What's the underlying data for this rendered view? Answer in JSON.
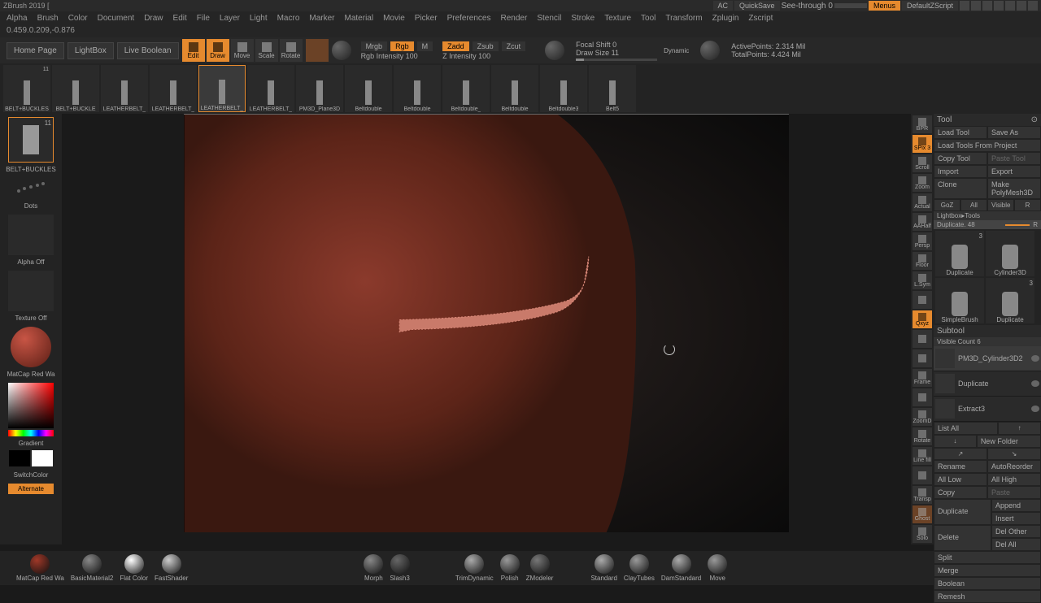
{
  "title": "ZBrush 2019 [",
  "titlebar": {
    "ac": "AC",
    "quicksave": "QuickSave",
    "seethrough": "See-through  0",
    "menus": "Menus",
    "default_script": "DefaultZScript"
  },
  "menu": [
    "Alpha",
    "Brush",
    "Color",
    "Document",
    "Draw",
    "Edit",
    "File",
    "Layer",
    "Light",
    "Macro",
    "Marker",
    "Material",
    "Movie",
    "Picker",
    "Preferences",
    "Render",
    "Stencil",
    "Stroke",
    "Texture",
    "Tool",
    "Transform",
    "Zplugin",
    "Zscript"
  ],
  "coords": "0.459.0.209,-0.876",
  "topbar": {
    "home": "Home Page",
    "lightbox": "LightBox",
    "live_boolean": "Live Boolean",
    "modes": [
      "Edit",
      "Draw",
      "Move",
      "Scale",
      "Rotate"
    ],
    "mrgb": "Mrgb",
    "rgb": "Rgb",
    "m": "M",
    "rgb_intensity": "Rgb Intensity 100",
    "zadd": "Zadd",
    "zsub": "Zsub",
    "zcut": "Zcut",
    "z_intensity": "Z Intensity 100",
    "focal_shift": "Focal Shift 0",
    "draw_size": "Draw Size 11",
    "dynamic": "Dynamic",
    "active_points": "ActivePoints: 2.314 Mil",
    "total_points": "TotalPoints: 4.424 Mil"
  },
  "thumbnails": [
    {
      "label": "BELT+BUCKLES",
      "badge": "11"
    },
    {
      "label": "BELT+BUCKLE"
    },
    {
      "label": "LEATHERBELT_"
    },
    {
      "label": "LEATHERBELT_"
    },
    {
      "label": "LEATHERBELT_",
      "selected": true
    },
    {
      "label": "LEATHERBELT_"
    },
    {
      "label": "PM3D_Plane3D"
    },
    {
      "label": "Beltdouble"
    },
    {
      "label": "Beltdouble"
    },
    {
      "label": "Beltdouble_"
    },
    {
      "label": "Beltdouble"
    },
    {
      "label": "Beltdouble3"
    },
    {
      "label": "Belt5"
    }
  ],
  "left_panel": {
    "brush_label": "BELT+BUCKLES",
    "dots": "Dots",
    "alpha_off": "Alpha Off",
    "texture_off": "Texture Off",
    "material": "MatCap Red Wa",
    "gradient": "Gradient",
    "switch_color": "SwitchColor",
    "alternate": "Alternate"
  },
  "right_shelf": [
    "BPR",
    "SPix 3",
    "Scroll",
    "Zoom",
    "Actual",
    "AAHalf",
    "Persp",
    "Floor",
    "L.Sym",
    "",
    "Qxyz",
    "",
    "",
    "Frame",
    "",
    "ZoomD",
    "Rotate",
    "Line fill",
    "",
    "Transp",
    "Ghost",
    "Solo"
  ],
  "tool_panel": {
    "header": "Tool",
    "buttons": [
      "Load Tool",
      "Save As",
      "Load Tools From Project",
      "Copy Tool",
      "Paste Tool",
      "Import",
      "Export",
      "Clone",
      "Make PolyMesh3D",
      "GoZ",
      "All",
      "Visible",
      "R"
    ],
    "lightbox_tools": "Lightbox▸Tools",
    "duplicate": "Duplicate. 48",
    "r": "R",
    "tools": [
      {
        "label": "Duplicate",
        "badge": "3"
      },
      {
        "label": "Cylinder3D"
      },
      {
        "label": "SimpleBrush"
      },
      {
        "label": "Duplicate",
        "badge": "3"
      }
    ],
    "subtool": "Subtool",
    "visible_count": "Visible Count 6",
    "subtools": [
      {
        "label": "PM3D_Cylinder3D2",
        "selected": true
      },
      {
        "label": "Duplicate"
      },
      {
        "label": "Extract3"
      }
    ],
    "list_all": "List All",
    "new_folder": "New Folder",
    "ops": [
      "Rename",
      "AutoReorder",
      "All Low",
      "All High",
      "Copy",
      "Paste"
    ],
    "duplicate_btn": "Duplicate",
    "append": "Append",
    "insert": "Insert",
    "delete": "Delete",
    "del_other": "Del Other",
    "del_all": "Del All",
    "split": "Split",
    "merge": "Merge",
    "boolean": "Boolean",
    "remesh": "Remesh"
  },
  "bottom_bar": [
    {
      "label": "MatCap Red Wa",
      "color": "#a03828"
    },
    {
      "label": "BasicMaterial2",
      "color": "#888"
    },
    {
      "label": "Flat Color",
      "color": "#fff"
    },
    {
      "label": "FastShader",
      "color": "#ccc"
    },
    {
      "label": "Morph",
      "color": "#888"
    },
    {
      "label": "Slash3",
      "color": "#666"
    },
    {
      "label": "TrimDynamic",
      "color": "#aaa"
    },
    {
      "label": "Polish",
      "color": "#999"
    },
    {
      "label": "ZModeler",
      "color": "#777"
    },
    {
      "label": "Standard",
      "color": "#aaa"
    },
    {
      "label": "ClayTubes",
      "color": "#999"
    },
    {
      "label": "DamStandard",
      "color": "#aaa"
    },
    {
      "label": "Move",
      "color": "#999"
    }
  ]
}
